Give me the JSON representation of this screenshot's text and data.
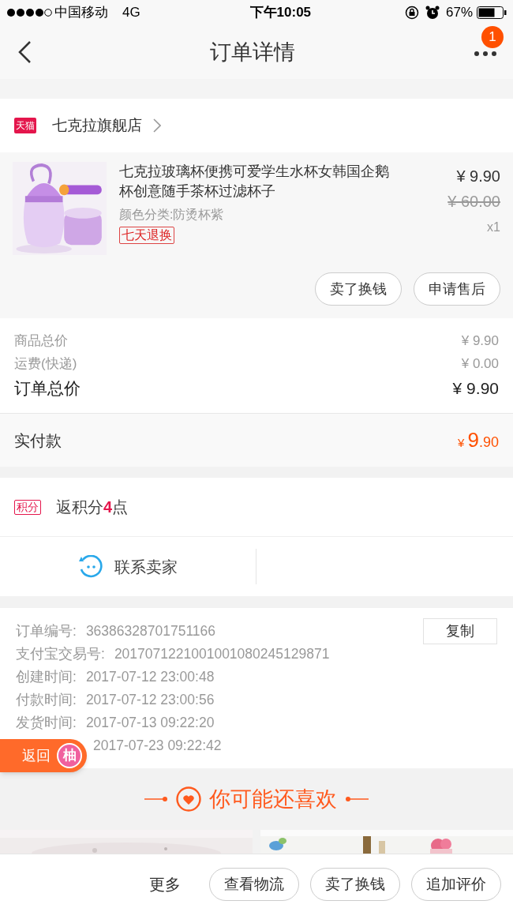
{
  "status_bar": {
    "carrier": "中国移动",
    "network": "4G",
    "time": "下午10:05",
    "battery": "67%"
  },
  "nav": {
    "title": "订单详情",
    "badge": "1"
  },
  "store": {
    "badge": "天猫",
    "name": "七克拉旗舰店"
  },
  "product": {
    "image": {
      "kind": "picture"
    },
    "title": "七克拉玻璃杯便携可爱学生水杯女韩国企鹅杯创意随手茶杯过滤杯子",
    "variant": "颜色分类:防烫杯紫",
    "tag": "七天退换",
    "price": "¥ 9.90",
    "original_price": "¥ 60.00",
    "quantity": "x1",
    "buttons": [
      "卖了换钱",
      "申请售后"
    ]
  },
  "summary": {
    "rows": [
      {
        "kind": "minor",
        "label": "商品总价",
        "value": "¥ 9.90"
      },
      {
        "kind": "minor",
        "label": "运费(快递)",
        "value": "¥ 0.00"
      },
      {
        "kind": "total",
        "label": "订单总价",
        "value": "¥ 9.90"
      }
    ],
    "paid": {
      "label": "实付款",
      "currency": "¥",
      "integer": "9",
      "decimal": ".90"
    }
  },
  "points": {
    "badge": "积分",
    "prefix": "返积分",
    "amount": "4",
    "suffix": "点"
  },
  "contact": {
    "label": "联系卖家"
  },
  "order_info": {
    "copy_button": "复制",
    "rows": [
      {
        "label": "订单编号:",
        "value": "36386328701751166"
      },
      {
        "label": "支付宝交易号:",
        "value": "2017071221001001080245129871"
      },
      {
        "label": "创建时间:",
        "value": "2017-07-12 23:00:48"
      },
      {
        "label": "付款时间:",
        "value": "2017-07-12 23:00:56"
      },
      {
        "label": "发货时间:",
        "value": "2017-07-13 09:22:20"
      },
      {
        "value": "2017-07-23 09:22:42"
      }
    ]
  },
  "float_button": {
    "label": "返回",
    "badge": "柚"
  },
  "recommend": {
    "title": "你可能还喜欢",
    "items": [
      {
        "kind": "picture"
      },
      {
        "kind": "picture"
      }
    ]
  },
  "bottom_bar": {
    "more": "更多",
    "buttons": [
      "查看物流",
      "卖了换钱",
      "追加评价"
    ]
  }
}
